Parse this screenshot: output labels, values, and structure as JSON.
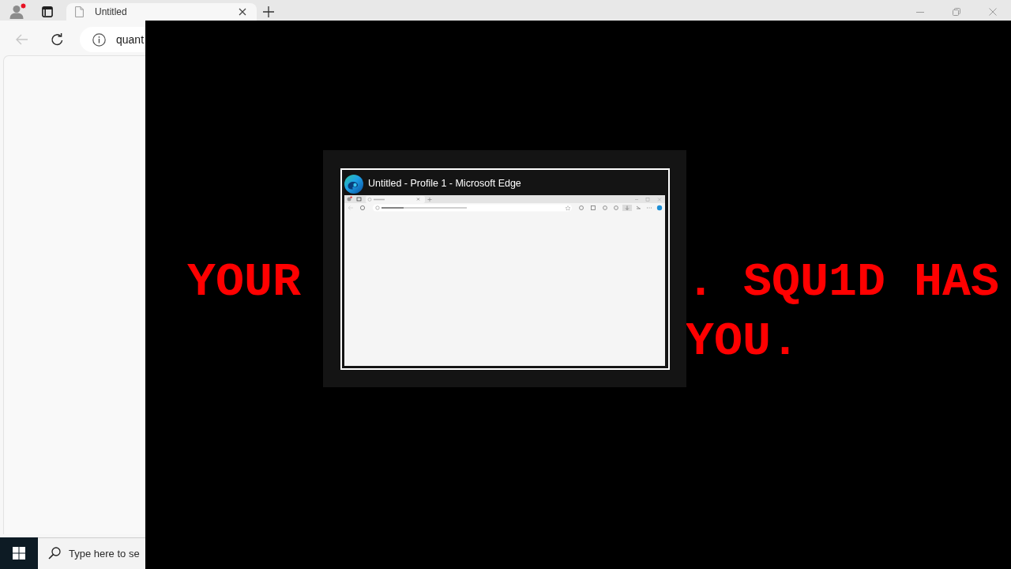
{
  "browser": {
    "tab": {
      "title": "Untitled"
    },
    "back_button": {
      "disabled": true
    },
    "address_bar": {
      "value": "quant"
    }
  },
  "ransom_screen": {
    "lines": [
      [
        "YOUR",
        ". SQU1D HAS"
      ],
      [
        "YOU."
      ]
    ]
  },
  "task_switcher": {
    "windows": [
      {
        "title": "Untitled - Profile 1 - Microsoft Edge",
        "selected": true
      }
    ]
  },
  "taskbar": {
    "search": {
      "placeholder": "Type here to se"
    }
  }
}
